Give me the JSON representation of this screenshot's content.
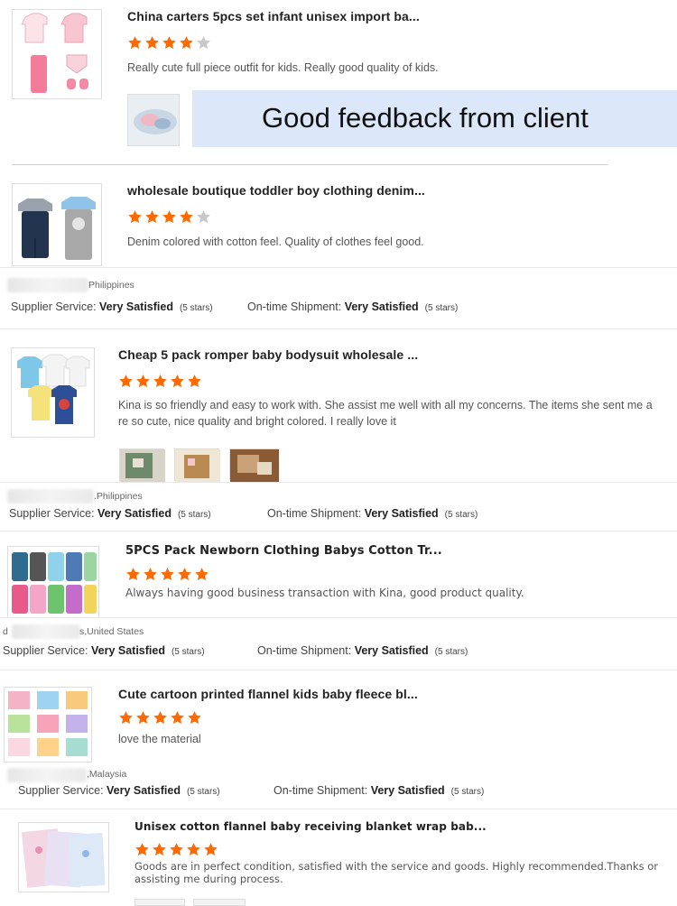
{
  "colors": {
    "star_fill": "#FF6A00",
    "star_empty": "#C8C8C8",
    "banner_bg": "#DCE8FA"
  },
  "banner": {
    "text": "Good feedback from client"
  },
  "reviews": [
    {
      "title": "China carters 5pcs set infant unisex import ba...",
      "rating": 4,
      "comment": "Really cute full piece outfit for kids.  Really good quality of kids."
    },
    {
      "title": "wholesale boutique toddler boy clothing denim...",
      "rating": 4,
      "comment": "Denim colored with cotton feel.   Quality of clothes feel good.",
      "country": "Philippines",
      "supplier_label": "Supplier Service:",
      "supplier_value": "Very Satisfied",
      "supplier_stars": "(5 stars)",
      "shipment_label": "On-time Shipment:",
      "shipment_value": "Very Satisfied",
      "shipment_stars": "(5 stars)"
    },
    {
      "title": "Cheap 5 pack romper baby bodysuit wholesale ...",
      "rating": 5,
      "comment": "Kina is so friendly and easy to work with. She assist me well with all my concerns. The items she sent me a re so cute, nice quality and bright colored. I really love it",
      "country": ".Philippines",
      "supplier_label": "Supplier Service:",
      "supplier_value": "Very Satisfied",
      "supplier_stars": "(5 stars)",
      "shipment_label": "On-time Shipment:",
      "shipment_value": "Very Satisfied",
      "shipment_stars": "(5 stars)"
    },
    {
      "title": "5PCS Pack Newborn Clothing Babys Cotton Tr...",
      "rating": 5,
      "comment": "Always having good business transaction with Kina, good product quality.",
      "country_prefix": "d",
      "country": "s,United States",
      "supplier_label": "Supplier Service:",
      "supplier_value": "Very Satisfied",
      "supplier_stars": "(5 stars)",
      "shipment_label": "On-time Shipment:",
      "shipment_value": "Very Satisfied",
      "shipment_stars": "(5 stars)"
    },
    {
      "title": "Cute cartoon printed flannel kids baby fleece bl...",
      "rating": 5,
      "comment": "love the material",
      "country": ",Malaysia",
      "supplier_label": "Supplier Service:",
      "supplier_value": "Very Satisfied",
      "supplier_stars": "(5 stars)",
      "shipment_label": "On-time Shipment:",
      "shipment_value": "Very Satisfied",
      "shipment_stars": "(5 stars)"
    },
    {
      "title": "Unisex cotton flannel baby receiving blanket wrap bab...",
      "rating": 5,
      "comment": "Goods are in perfect condition, satisfied with the service and goods. Highly recommended.Thanks or assisting me during process."
    }
  ]
}
